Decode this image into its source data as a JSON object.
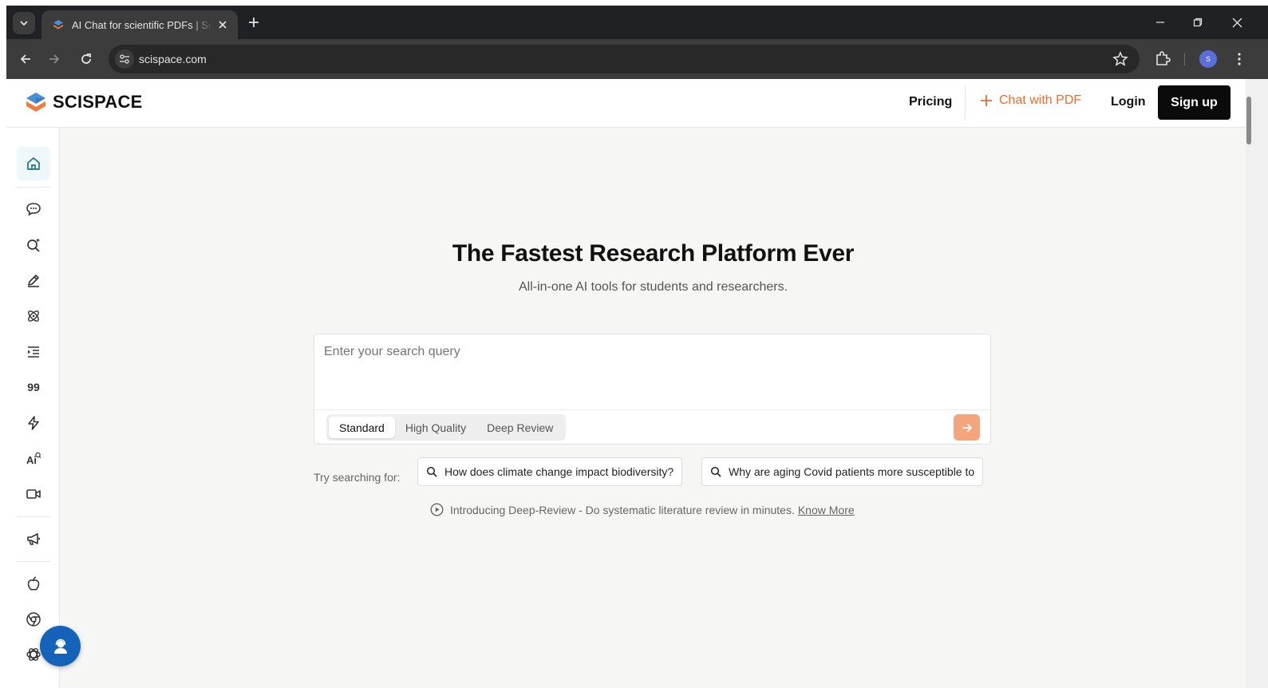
{
  "browser": {
    "tab_title": "AI Chat for scientific PDFs | SciSpace",
    "url": "scispace.com",
    "profile_initial": "S"
  },
  "header": {
    "logo_text": "SCISPACE",
    "pricing": "Pricing",
    "chat_with_pdf": "Chat with PDF",
    "login": "Login",
    "signup": "Sign up"
  },
  "sidebar": {
    "items": [
      {
        "icon": "home-icon"
      },
      {
        "icon": "chat-bubble-icon"
      },
      {
        "icon": "search-sparkle-icon"
      },
      {
        "icon": "pen-write-icon"
      },
      {
        "icon": "atom-icon"
      },
      {
        "icon": "list-indent-icon"
      },
      {
        "icon": "citation-icon",
        "label": "99"
      },
      {
        "icon": "lightning-icon"
      },
      {
        "icon": "ai-detector-icon"
      },
      {
        "icon": "video-icon"
      },
      {
        "icon": "megaphone-icon"
      },
      {
        "icon": "apple-icon"
      },
      {
        "icon": "chrome-icon"
      },
      {
        "icon": "openai-icon"
      }
    ]
  },
  "hero": {
    "title": "The Fastest Research Platform Ever",
    "subtitle": "All-in-one AI tools for students and researchers."
  },
  "search": {
    "placeholder": "Enter your search query",
    "value": "",
    "modes": [
      "Standard",
      "High Quality",
      "Deep Review"
    ],
    "selected_mode": "Standard"
  },
  "suggestions": {
    "label": "Try searching for:",
    "items": [
      "How does climate change impact biodiversity?",
      "Why are aging Covid patients more susceptible to"
    ]
  },
  "announcement": {
    "text": "Introducing Deep-Review - Do systematic literature review in minutes.",
    "link": "Know More"
  },
  "colors": {
    "accent_orange": "#f06a2c",
    "go_button": "#f4a57d",
    "fab_blue": "#1463b8",
    "signup_bg": "#0b0b0b"
  }
}
